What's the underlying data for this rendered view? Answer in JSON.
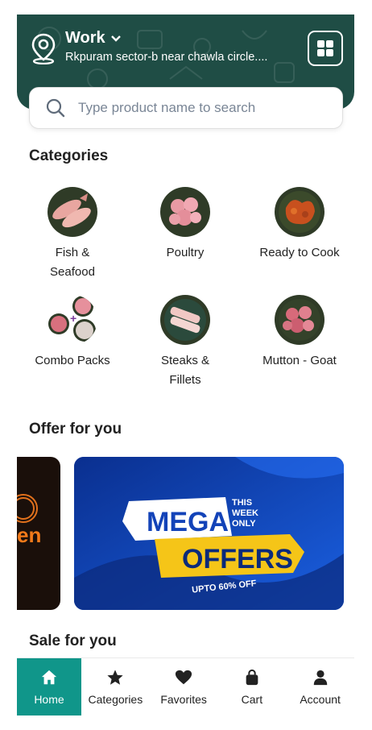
{
  "header": {
    "location_title": "Work",
    "address": "Rkpuram sector-b near chawla circle....",
    "icons": [
      "location-pin-icon",
      "chevron-down-icon",
      "grid-menu-icon"
    ]
  },
  "search": {
    "placeholder": "Type product name to search"
  },
  "categories_section": {
    "title": "Categories",
    "items": [
      {
        "label": "Fish &\nSeafood",
        "icon": "fish-icon"
      },
      {
        "label": "Poultry",
        "icon": "chicken-icon"
      },
      {
        "label": "Ready to Cook",
        "icon": "marinated-meat-icon"
      },
      {
        "label": "Combo Packs",
        "icon": "combo-icon"
      },
      {
        "label": "Steaks &\nFillets",
        "icon": "fillet-icon"
      },
      {
        "label": "Mutton - Goat",
        "icon": "mutton-icon"
      }
    ]
  },
  "offers_section": {
    "title": "Offer for you",
    "left_banner": {
      "text_fragment": "en"
    },
    "main_banner": {
      "line1": "MEGA",
      "badge": [
        "THIS",
        "WEEK",
        "ONLY"
      ],
      "line2": "OFFERS",
      "footer": "UPTO 60% OFF"
    }
  },
  "sale_section": {
    "title": "Sale for you"
  },
  "nav": {
    "items": [
      {
        "label": "Home",
        "icon": "home-icon",
        "active": true
      },
      {
        "label": "Categories",
        "icon": "star-icon",
        "active": false
      },
      {
        "label": "Favorites",
        "icon": "heart-icon",
        "active": false
      },
      {
        "label": "Cart",
        "icon": "bag-icon",
        "active": false
      },
      {
        "label": "Account",
        "icon": "user-icon",
        "active": false
      }
    ]
  },
  "colors": {
    "header_bg": "#1f4d45",
    "nav_active": "#10968a",
    "offer_blue": "#1243b8",
    "offer_yellow": "#f5c518"
  }
}
